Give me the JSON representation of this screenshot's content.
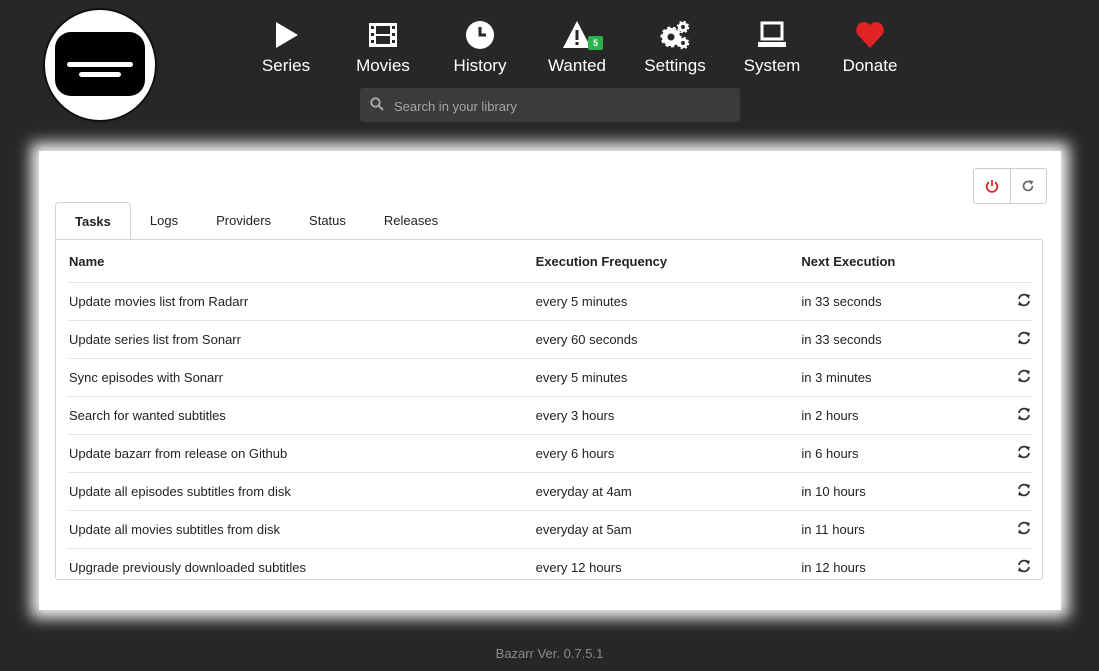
{
  "nav": {
    "items": [
      {
        "label": "Series",
        "icon": "play-icon"
      },
      {
        "label": "Movies",
        "icon": "film-icon"
      },
      {
        "label": "History",
        "icon": "clock-icon"
      },
      {
        "label": "Wanted",
        "icon": "warning-icon",
        "badge": "5"
      },
      {
        "label": "Settings",
        "icon": "gears-icon"
      },
      {
        "label": "System",
        "icon": "laptop-icon"
      },
      {
        "label": "Donate",
        "icon": "heart-icon"
      }
    ]
  },
  "search": {
    "placeholder": "Search in your library"
  },
  "tabs": [
    "Tasks",
    "Logs",
    "Providers",
    "Status",
    "Releases"
  ],
  "table": {
    "headers": [
      "Name",
      "Execution Frequency",
      "Next Execution"
    ],
    "rows": [
      [
        "Update movies list from Radarr",
        "every 5 minutes",
        "in 33 seconds"
      ],
      [
        "Update series list from Sonarr",
        "every 60 seconds",
        "in 33 seconds"
      ],
      [
        "Sync episodes with Sonarr",
        "every 5 minutes",
        "in 3 minutes"
      ],
      [
        "Search for wanted subtitles",
        "every 3 hours",
        "in 2 hours"
      ],
      [
        "Update bazarr from release on Github",
        "every 6 hours",
        "in 6 hours"
      ],
      [
        "Update all episodes subtitles from disk",
        "everyday at 4am",
        "in 10 hours"
      ],
      [
        "Update all movies subtitles from disk",
        "everyday at 5am",
        "in 11 hours"
      ],
      [
        "Upgrade previously downloaded subtitles",
        "every 12 hours",
        "in 12 hours"
      ]
    ]
  },
  "colors": {
    "donate_heart": "#e02424",
    "power": "#db2828",
    "badge": "#2bb24c"
  },
  "footer": {
    "version": "Bazarr Ver. 0.7.5.1"
  }
}
